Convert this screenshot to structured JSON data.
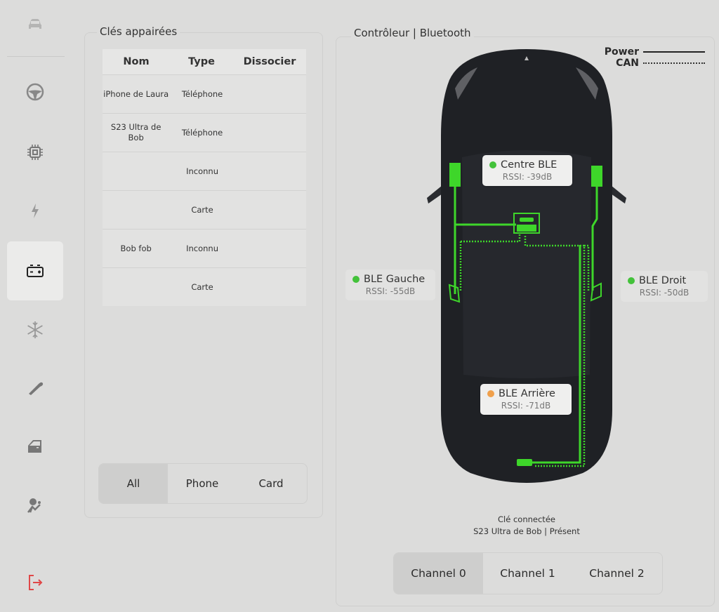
{
  "sidebar": {
    "items": [
      {
        "icon": "car-icon",
        "active": false
      },
      {
        "icon": "steering-wheel-icon",
        "active": false
      },
      {
        "icon": "chip-icon",
        "active": false
      },
      {
        "icon": "lightning-icon",
        "active": false
      },
      {
        "icon": "battery-icon",
        "active": true
      },
      {
        "icon": "snowflake-icon",
        "active": false
      },
      {
        "icon": "wiper-icon",
        "active": false
      },
      {
        "icon": "door-icon",
        "active": false
      },
      {
        "icon": "airbag-icon",
        "active": false
      },
      {
        "icon": "logout-icon",
        "active": false
      }
    ],
    "logout_color": "#e04848"
  },
  "keys": {
    "title": "Clés appairées",
    "columns": [
      "Nom",
      "Type",
      "Dissocier"
    ],
    "rows": [
      {
        "name": "iPhone de Laura",
        "type": "Téléphone"
      },
      {
        "name": "S23 Ultra de Bob",
        "type": "Téléphone"
      },
      {
        "name": "",
        "type": "Inconnu"
      },
      {
        "name": "",
        "type": "Carte"
      },
      {
        "name": "Bob fob",
        "type": "Inconnu"
      },
      {
        "name": "",
        "type": "Carte"
      }
    ],
    "filter": {
      "options": [
        "All",
        "Phone",
        "Card"
      ],
      "selected": "All"
    }
  },
  "controller": {
    "title": "Contrôleur | Bluetooth",
    "legend": {
      "power": "Power",
      "can": "CAN"
    },
    "wire_color": "#3ed62a",
    "ble": {
      "centre": {
        "name": "Centre BLE",
        "rssi": "RSSI: -39dB",
        "status_color": "#43c23a"
      },
      "gauche": {
        "name": "BLE Gauche",
        "rssi": "RSSI: -55dB",
        "status_color": "#43c23a"
      },
      "droit": {
        "name": "BLE Droit",
        "rssi": "RSSI: -50dB",
        "status_color": "#43c23a"
      },
      "arriere": {
        "name": "BLE Arrière",
        "rssi": "RSSI: -71dB",
        "status_color": "#f0a04b"
      }
    },
    "connected_label": "Clé connectée",
    "connected_value": "S23 Ultra de Bob | Présent",
    "channels": {
      "options": [
        "Channel 0",
        "Channel 1",
        "Channel 2"
      ],
      "selected": "Channel 0"
    }
  }
}
